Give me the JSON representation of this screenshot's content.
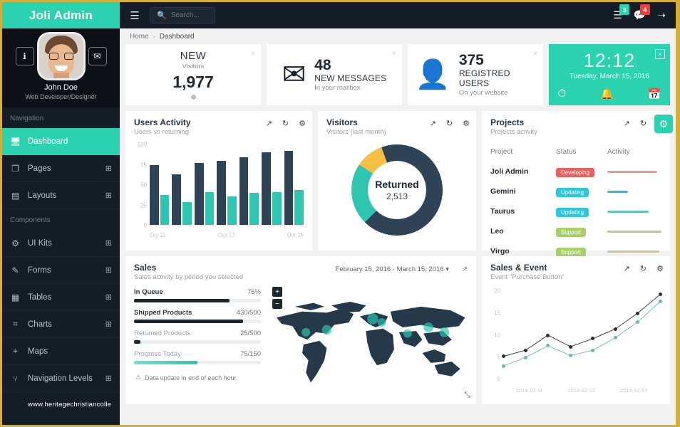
{
  "brand": {
    "title": "Joli Admin"
  },
  "topbar": {
    "menu_icon": "hamburger-icon",
    "search_placeholder": "Search...",
    "search_value": "",
    "notes_badge": "3",
    "chat_badge": "4",
    "logout_icon": "logout-icon"
  },
  "breadcrumb": {
    "home": "Home",
    "separator": "›",
    "current": "Dashboard"
  },
  "profile": {
    "name": "John Doe",
    "role": "Web Developer/Designer",
    "info_icon": "info-icon",
    "mail_icon": "envelope-icon"
  },
  "sidebar": {
    "caption_navigation": "Navigation",
    "caption_components": "Components",
    "items": [
      {
        "label": "Dashboard",
        "icon": "🖥",
        "icon_name": "monitor-icon",
        "active": true,
        "expandable": false
      },
      {
        "label": "Pages",
        "icon": "❐",
        "icon_name": "pages-icon",
        "active": false,
        "expandable": true
      },
      {
        "label": "Layouts",
        "icon": "▤",
        "icon_name": "layouts-icon",
        "active": false,
        "expandable": true
      },
      {
        "label": "UI Kits",
        "icon": "⚙",
        "icon_name": "ui-kits-icon",
        "active": false,
        "expandable": true
      },
      {
        "label": "Forms",
        "icon": "✎",
        "icon_name": "pencil-icon",
        "active": false,
        "expandable": true
      },
      {
        "label": "Tables",
        "icon": "▦",
        "icon_name": "table-icon",
        "active": false,
        "expandable": true
      },
      {
        "label": "Charts",
        "icon": "⌗",
        "icon_name": "chart-icon",
        "active": false,
        "expandable": true
      },
      {
        "label": "Maps",
        "icon": "⌖",
        "icon_name": "map-pin-icon",
        "active": false,
        "expandable": false
      },
      {
        "label": "Navigation Levels",
        "icon": "⑂",
        "icon_name": "sitemap-icon",
        "active": false,
        "expandable": true
      }
    ],
    "expand_glyph": "⊞",
    "watermark": "www.heritagechristiancolle"
  },
  "stats": {
    "visitors": {
      "title": "NEW",
      "subtitle": "Visitors",
      "value": "1,977",
      "close": "×"
    },
    "messages": {
      "value": "48",
      "label": "NEW MESSAGES",
      "sub": "In your mailbox",
      "icon_name": "envelope-icon",
      "close": "×"
    },
    "users": {
      "value": "375",
      "label": "REGISTRED USERS",
      "sub": "On your website",
      "icon_name": "user-icon",
      "close": "×"
    },
    "clock": {
      "time": "12:12",
      "date": "Tuesday, March 15, 2016",
      "close": "×",
      "icons": [
        "clock-icon",
        "bell-icon",
        "calendar-icon"
      ]
    }
  },
  "panels": {
    "users_activity": {
      "title": "Users Activity",
      "subtitle": "Users vs returning"
    },
    "visitors": {
      "title": "Visitors",
      "subtitle": "Visitors (last month)"
    },
    "projects": {
      "title": "Projects",
      "subtitle": "Projects activity"
    },
    "sales": {
      "title": "Sales",
      "subtitle": "Sales activity by period you selected",
      "range": "February 15, 2016 - March 15, 2016 ▾"
    },
    "sales_event": {
      "title": "Sales & Event",
      "subtitle": "Event \"Purchase Button\""
    },
    "actions": {
      "expand": "↗",
      "refresh": "↻",
      "settings": "⚙"
    }
  },
  "projects_table": {
    "headers": [
      "Project",
      "Status",
      "Activity"
    ],
    "rows": [
      {
        "name": "Joli Admin",
        "status": "Developing",
        "status_color": "red",
        "activity": 92,
        "bar_color": "#d9a0a0"
      },
      {
        "name": "Gemini",
        "status": "Updating",
        "status_color": "teal",
        "activity": 38,
        "bar_color": "#58b0ad"
      },
      {
        "name": "Taurus",
        "status": "Updating",
        "status_color": "teal",
        "activity": 76,
        "bar_color": "#5fc3bb"
      },
      {
        "name": "Leo",
        "status": "Support",
        "status_color": "green",
        "activity": 100,
        "bar_color": "#c3bfa0"
      },
      {
        "name": "Virgo",
        "status": "Support",
        "status_color": "green",
        "activity": 96,
        "bar_color": "#c8c4a6"
      }
    ]
  },
  "sales_progress": [
    {
      "label": "In Queue",
      "value": "75%",
      "percent": 75,
      "fill": "dark",
      "muted": false
    },
    {
      "label": "Shipped Products",
      "value": "430/500",
      "percent": 86,
      "fill": "dark",
      "muted": false
    },
    {
      "label": "Returned Products",
      "value": "25/500",
      "percent": 5,
      "fill": "dark",
      "muted": true
    },
    {
      "label": "Progress Today",
      "value": "75/150",
      "percent": 50,
      "fill": "tealgrad",
      "muted": true
    }
  ],
  "sales_note": {
    "icon": "⚠",
    "text": "Data update in end of each hour."
  },
  "map": {
    "zoom_in": "+",
    "zoom_out": "−",
    "expand": "⤡"
  },
  "fab": {
    "icon_name": "gear-icon",
    "glyph": "⚙"
  },
  "chart_data": [
    {
      "type": "bar",
      "title": "Users Activity",
      "subtitle": "Users vs returning",
      "categories": [
        "Oct 11",
        "",
        "",
        "Oct 13",
        "",
        "",
        "Oct 16"
      ],
      "xlabel": "",
      "ylabel": "",
      "ylim": [
        0,
        100
      ],
      "yticks": [
        100,
        75,
        50,
        25,
        0
      ],
      "grid": false,
      "legend": "none",
      "series": [
        {
          "name": "Users",
          "color": "#2e4355",
          "values": [
            74,
            63,
            77,
            80,
            84,
            90,
            92
          ]
        },
        {
          "name": "Returning",
          "color": "#2ec6b0",
          "values": [
            37,
            28,
            41,
            35,
            40,
            41,
            43
          ]
        }
      ]
    },
    {
      "type": "pie",
      "title": "Visitors",
      "subtitle": "Visitors (last month)",
      "center_label": "Returned",
      "center_value": "2,513",
      "labels": [
        "Returned",
        "New",
        "Other"
      ],
      "values": [
        68,
        22,
        10
      ],
      "colors": [
        "#2e4355",
        "#2ec6b0",
        "#f5c042"
      ],
      "legend": "none"
    },
    {
      "type": "line",
      "title": "Sales & Event",
      "subtitle": "Event \"Purchase Button\"",
      "x": [
        "2014-10-11",
        "",
        "",
        "2014-12-13",
        "",
        "",
        "2014-12-17",
        ""
      ],
      "xticklabels": [
        "2014-10-11",
        "2014-12-13",
        "2014-12-17"
      ],
      "ylim": [
        0,
        20
      ],
      "yticks": [
        20,
        15,
        10,
        5,
        0
      ],
      "grid": false,
      "legend": "none",
      "series": [
        {
          "name": "Sales",
          "color": "#283039",
          "values": [
            5.2,
            6.6,
            10.0,
            7.4,
            9.2,
            11.4,
            15.0,
            19.2
          ]
        },
        {
          "name": "Event",
          "color": "#6db5ad",
          "values": [
            3.0,
            5.0,
            7.6,
            5.4,
            6.6,
            9.4,
            13.0,
            17.6
          ]
        }
      ]
    }
  ]
}
